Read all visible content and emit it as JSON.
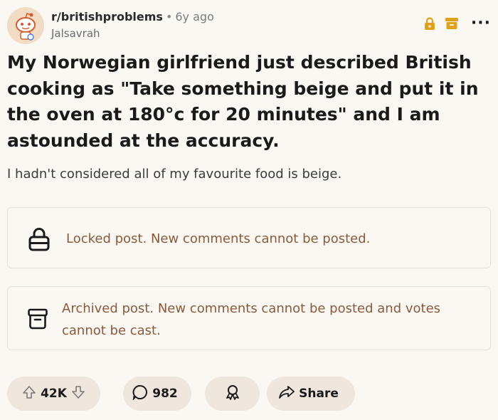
{
  "post": {
    "subreddit": "r/britishproblems",
    "separator": "•",
    "time": "6y ago",
    "author": "Jalsavrah",
    "title": "My Norwegian girlfriend just described British cooking as \"Take something beige and put it in the oven at 180°c for 20 minutes\" and I am astounded at the accuracy.",
    "body": "I hadn't considered all of my favourite food is beige."
  },
  "header_icons": [
    "lock-icon",
    "archive-icon",
    "more-options-icon"
  ],
  "notices": {
    "locked": "Locked post. New comments cannot be posted.",
    "archived": "Archived post. New comments cannot be posted and votes cannot be cast."
  },
  "actions": {
    "votes": "42K",
    "comments": "982",
    "share": "Share"
  },
  "colors": {
    "background": "#fbf8f4",
    "icon_accent": "#e0a019",
    "notice_text": "#8a5a3a",
    "pill": "#efe6dd"
  }
}
